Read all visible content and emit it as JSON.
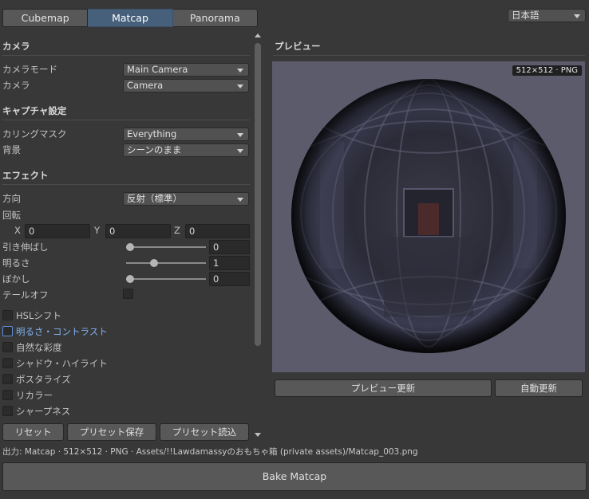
{
  "tabs": [
    {
      "label": "Cubemap",
      "active": false
    },
    {
      "label": "Matcap",
      "active": true
    },
    {
      "label": "Panorama",
      "active": false
    }
  ],
  "language": {
    "value": "日本語"
  },
  "camera_section": {
    "title": "カメラ",
    "mode_label": "カメラモード",
    "mode_value": "Main Camera",
    "camera_label": "カメラ",
    "camera_value": "Camera"
  },
  "capture_section": {
    "title": "キャプチャ設定",
    "culling_label": "カリングマスク",
    "culling_value": "Everything",
    "background_label": "背景",
    "background_value": "シーンのまま"
  },
  "effect_section": {
    "title": "エフェクト",
    "direction_label": "方向",
    "direction_value": "反射（標準）",
    "rotation_label": "回転",
    "rot_x_label": "X",
    "rot_x_value": "0",
    "rot_y_label": "Y",
    "rot_y_value": "0",
    "rot_z_label": "Z",
    "rot_z_value": "0",
    "stretch_label": "引き伸ばし",
    "stretch_value": "0",
    "stretch_fraction": 0,
    "brightness_label": "明るさ",
    "brightness_value": "1",
    "brightness_fraction": 0.33,
    "blur_label": "ぼかし",
    "blur_value": "0",
    "blur_fraction": 0,
    "falloff_label": "テールオフ"
  },
  "options": [
    {
      "label": "HSLシフト",
      "checked": false,
      "highlighted": false
    },
    {
      "label": "明るさ・コントラスト",
      "checked": false,
      "highlighted": true
    },
    {
      "label": "自然な彩度",
      "checked": false,
      "highlighted": false
    },
    {
      "label": "シャドウ・ハイライト",
      "checked": false,
      "highlighted": false
    },
    {
      "label": "ポスタライズ",
      "checked": false,
      "highlighted": false
    },
    {
      "label": "リカラー",
      "checked": false,
      "highlighted": false
    },
    {
      "label": "シャープネス",
      "checked": false,
      "highlighted": false
    }
  ],
  "preset_buttons": {
    "reset": "リセット",
    "save": "プリセット保存",
    "load": "プリセット読込"
  },
  "preview": {
    "title": "プレビュー",
    "badge": "512×512 · PNG",
    "refresh_button": "プレビュー更新",
    "auto_button": "自動更新"
  },
  "output_text": "出力: Matcap · 512×512 · PNG · Assets/!!Lawdamassyのおもちゃ箱 (private assets)/Matcap_003.png",
  "bake_button": "Bake Matcap",
  "colors": {
    "accent": "#46607c",
    "highlight_text": "#7fb0f0",
    "panel": "#383838",
    "preview_bg": "#5b5b6c"
  }
}
